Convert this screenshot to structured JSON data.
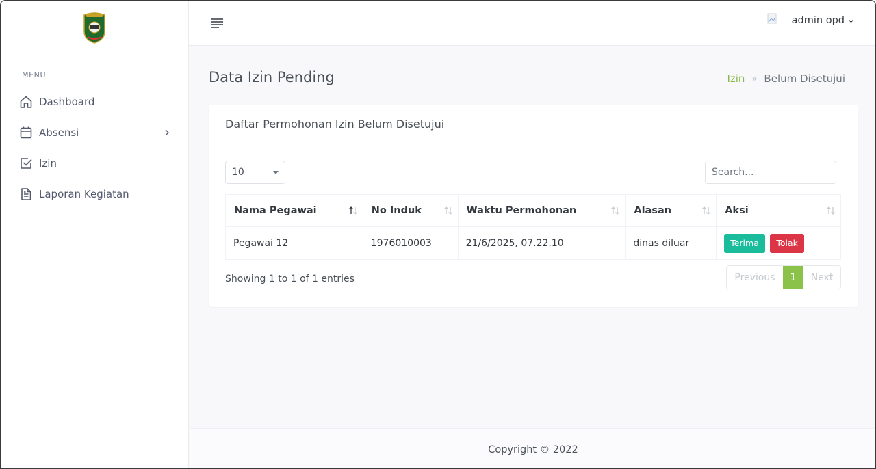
{
  "sidebar": {
    "menu_title": "MENU",
    "items": [
      {
        "label": "Dashboard",
        "icon": "home-icon"
      },
      {
        "label": "Absensi",
        "icon": "calendar-icon"
      },
      {
        "label": "Izin",
        "icon": "checkbox-icon"
      },
      {
        "label": "Laporan Kegiatan",
        "icon": "document-icon"
      }
    ]
  },
  "topbar": {
    "user_name": "admin opd"
  },
  "page": {
    "title": "Data Izin Pending",
    "breadcrumb": {
      "link": "Izin",
      "separator": "»",
      "current": "Belum Disetujui"
    }
  },
  "card": {
    "title": "Daftar Permohonan Izin Belum Disetujui",
    "length_value": "10",
    "search_placeholder": "Search...",
    "columns": [
      "Nama Pegawai",
      "No Induk",
      "Waktu Permohonan",
      "Alasan",
      "Aksi"
    ],
    "rows": [
      {
        "nama": "Pegawai 12",
        "no_induk": "1976010003",
        "waktu": "21/6/2025, 07.22.10",
        "alasan": "dinas diluar",
        "accept": "Terima",
        "reject": "Tolak"
      }
    ],
    "info": "Showing 1 to 1 of 1 entries",
    "pagination": {
      "previous": "Previous",
      "page": "1",
      "next": "Next"
    }
  },
  "footer": {
    "copyright": "Copyright © 2022"
  },
  "colors": {
    "accent": "#8bc34a",
    "accept": "#1abc9c",
    "reject": "#dc3545"
  }
}
